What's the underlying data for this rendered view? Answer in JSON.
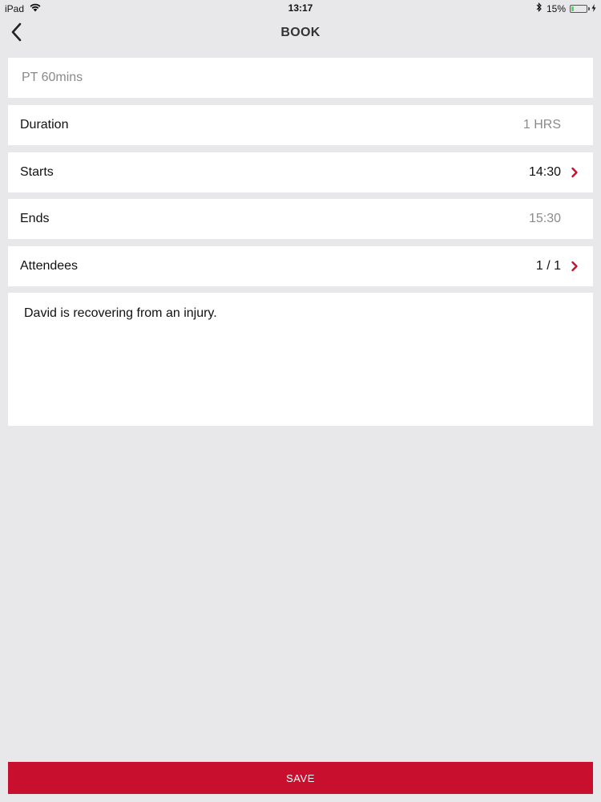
{
  "status_bar": {
    "device": "iPad",
    "time": "13:17",
    "battery": "15%",
    "battery_level": 0.15,
    "icons": [
      "wifi-icon",
      "bluetooth-icon",
      "battery-icon",
      "charging-icon"
    ]
  },
  "nav": {
    "title": "BOOK",
    "back_icon": "chevron-left-icon"
  },
  "form": {
    "session_name": "PT 60mins",
    "duration": {
      "label": "Duration",
      "value": "1 HRS"
    },
    "starts": {
      "label": "Starts",
      "value": "14:30"
    },
    "ends": {
      "label": "Ends",
      "value": "15:30"
    },
    "attendees": {
      "label": "Attendees",
      "value": "1 / 1"
    },
    "notes": "David is recovering from an injury."
  },
  "actions": {
    "save_label": "SAVE"
  },
  "colors": {
    "accent": "#c8102e",
    "background": "#e8e7ea",
    "muted_text": "#8a8a8e",
    "battery_green": "#4cd964"
  }
}
